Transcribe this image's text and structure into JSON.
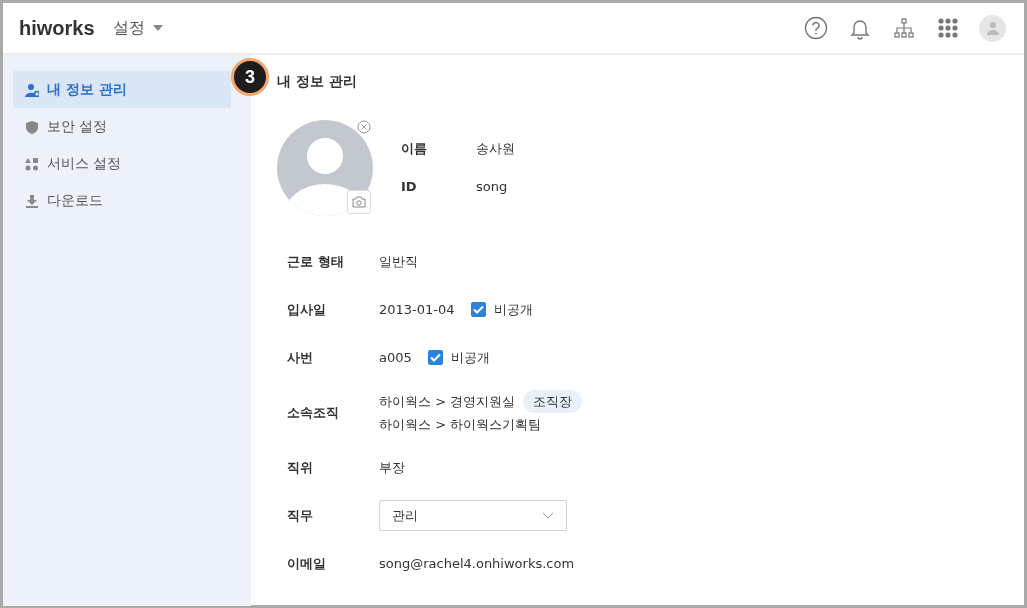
{
  "header": {
    "logo": "hiworks",
    "menu": "설정"
  },
  "step_badge": "3",
  "sidebar": {
    "items": [
      {
        "label": "내 정보 관리",
        "selected": true
      },
      {
        "label": "보안 설정",
        "selected": false
      },
      {
        "label": "서비스 설정",
        "selected": false
      },
      {
        "label": "다운로드",
        "selected": false
      }
    ]
  },
  "page_title": "내 정보 관리",
  "profile": {
    "fields": [
      {
        "label": "이름",
        "value": "송사원"
      },
      {
        "label": "ID",
        "value": "song"
      }
    ]
  },
  "fields": [
    {
      "kind": "text",
      "label": "근로 형태",
      "value": "일반직"
    },
    {
      "kind": "private",
      "label": "입사일",
      "value": "2013-01-04",
      "checkbox": {
        "label": "비공개",
        "checked": true
      }
    },
    {
      "kind": "private",
      "label": "사번",
      "value": "a005",
      "checkbox": {
        "label": "비공개",
        "checked": true
      }
    },
    {
      "kind": "org",
      "label": "소속조직",
      "lines": [
        {
          "text": "하이웍스 > 경영지원실",
          "tag": "조직장"
        },
        {
          "text": "하이웍스 > 하이웍스기획팀"
        }
      ]
    },
    {
      "kind": "text",
      "label": "직위",
      "value": "부장"
    },
    {
      "kind": "select",
      "label": "직무",
      "value": "관리"
    },
    {
      "kind": "text",
      "label": "이메일",
      "value": "song@rachel4.onhiworks.com"
    }
  ]
}
